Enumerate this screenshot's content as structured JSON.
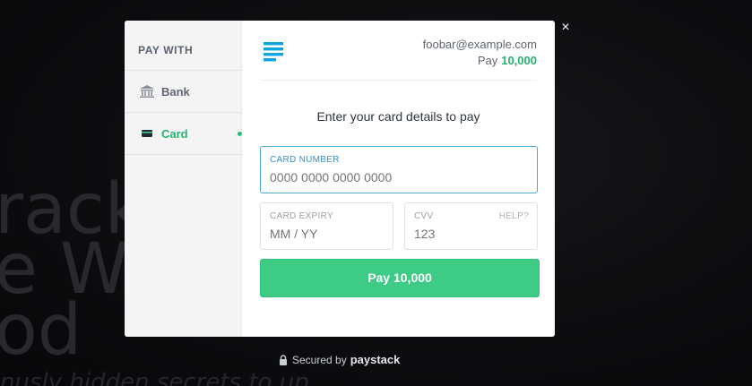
{
  "background": {
    "lines": [
      "rackh",
      "e Wri",
      "od"
    ],
    "subline": "nusly hidden secrets to up"
  },
  "close_icon": "×",
  "sidebar": {
    "title": "PAY WITH",
    "methods": [
      {
        "label": "Bank",
        "icon": "bank-icon",
        "active": false
      },
      {
        "label": "Card",
        "icon": "card-icon",
        "active": true
      }
    ]
  },
  "header": {
    "email": "foobar@example.com",
    "amount_prefix": "Pay",
    "amount": "10,000"
  },
  "form": {
    "prompt": "Enter your card details to pay",
    "card_number": {
      "label": "CARD NUMBER",
      "placeholder": "0000 0000 0000 0000"
    },
    "expiry": {
      "label": "CARD EXPIRY",
      "placeholder": "MM / YY"
    },
    "cvv": {
      "label": "CVV",
      "placeholder": "123",
      "help": "HELP?"
    },
    "pay_button": "Pay 10,000"
  },
  "footer": {
    "secured_text": "Secured by",
    "brand": "paystack"
  },
  "colors": {
    "accent_green": "#3ecb86",
    "amount_green": "#24b36f",
    "focus_blue": "#4aa6d6",
    "logo_blue": "#0ba4db"
  }
}
